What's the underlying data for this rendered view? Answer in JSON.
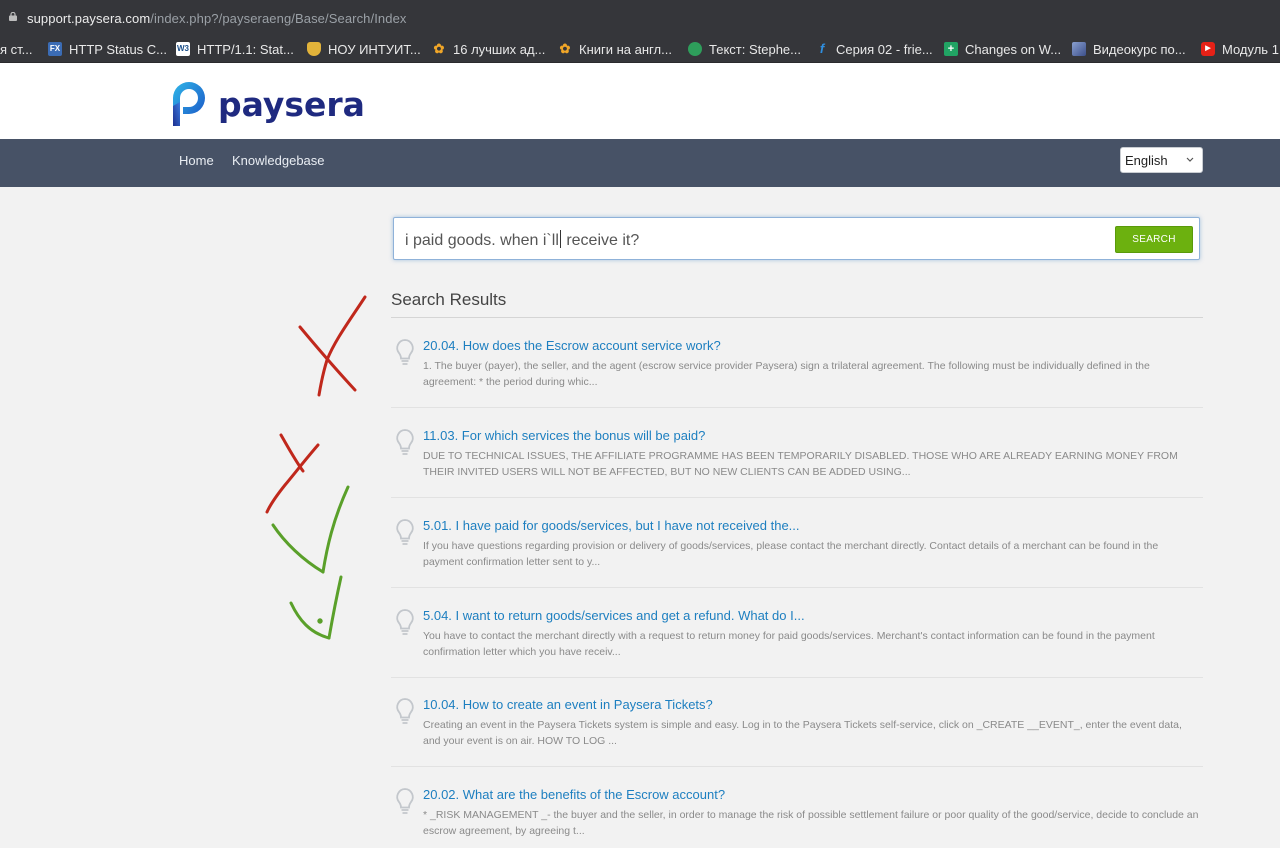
{
  "browser": {
    "url_host": "support.paysera.com",
    "url_path": "/index.php?/payseraeng/Base/Search/Index",
    "bookmarks": [
      {
        "label": "я ст...",
        "icon": "bookmark-icon"
      },
      {
        "label": "HTTP Status C...",
        "icon": "fx-icon"
      },
      {
        "label": "HTTP/1.1: Stat...",
        "icon": "w3-icon"
      },
      {
        "label": "НОУ ИНТУИТ...",
        "icon": "intuit-icon"
      },
      {
        "label": "16 лучших ад...",
        "icon": "yandex-paw-icon"
      },
      {
        "label": "Книги на англ...",
        "icon": "yandex-paw-icon"
      },
      {
        "label": "Текст: Stephe...",
        "icon": "green-globe-icon"
      },
      {
        "label": "Серия 02 - frie...",
        "icon": "f-icon"
      },
      {
        "label": "Changes on W...",
        "icon": "sheets-icon"
      },
      {
        "label": "Видеокурс по...",
        "icon": "image-icon"
      },
      {
        "label": "Модуль 1",
        "icon": "youtube-icon"
      }
    ]
  },
  "site": {
    "logo_text": "paysera",
    "nav": {
      "home": "Home",
      "kb": "Knowledgebase"
    },
    "language": "English"
  },
  "search": {
    "query_before_caret": "i paid goods. when i`ll",
    "query_after_caret": " receive it?",
    "button": "SEARCH"
  },
  "results": {
    "heading": "Search Results",
    "items": [
      {
        "title": "20.04. How does the Escrow account service work?",
        "snippet": "1. The buyer (payer), the seller, and the agent (escrow service provider Paysera) sign a trilateral agreement. The following must be individually defined in the agreement: * the period during whic..."
      },
      {
        "title": "11.03. For which services the bonus will be paid?",
        "snippet": "DUE TO TECHNICAL ISSUES, THE AFFILIATE PROGRAMME HAS BEEN TEMPORARILY DISABLED. THOSE WHO ARE ALREADY EARNING MONEY FROM THEIR INVITED USERS WILL NOT BE AFFECTED, BUT NO NEW CLIENTS CAN BE ADDED USING..."
      },
      {
        "title": "5.01. I have paid for goods/services, but I have not received the...",
        "snippet": "If you have questions regarding provision or delivery of goods/services, please contact the merchant directly. Contact details of a merchant can be found in the payment confirmation letter sent to y..."
      },
      {
        "title": "5.04. I want to return goods/services and get a refund. What do I...",
        "snippet": "You have to contact the merchant directly with a request to return money for paid goods/services. Merchant's contact information can be found in the payment confirmation letter which you have receiv..."
      },
      {
        "title": "10.04. How to create an event in Paysera Tickets?",
        "snippet": "Creating an event in the Paysera Tickets system is simple and easy. Log in to the Paysera Tickets self-service, click on _CREATE __EVENT_, enter the event data, and your event is on air. HOW TO LOG ..."
      },
      {
        "title": "20.02. What are the benefits of the Escrow account?",
        "snippet": "* _RISK MANAGEMENT _- the buyer and the seller, in order to manage the risk of possible settlement failure or poor quality of the good/service, decide to conclude an escrow agreement, by agreeing t..."
      }
    ]
  },
  "colors": {
    "nav_bg": "#475266",
    "link": "#1d7fc0",
    "search_button": "#6cb10f",
    "annotation_red": "#c0281c",
    "annotation_green": "#5aa02a"
  }
}
